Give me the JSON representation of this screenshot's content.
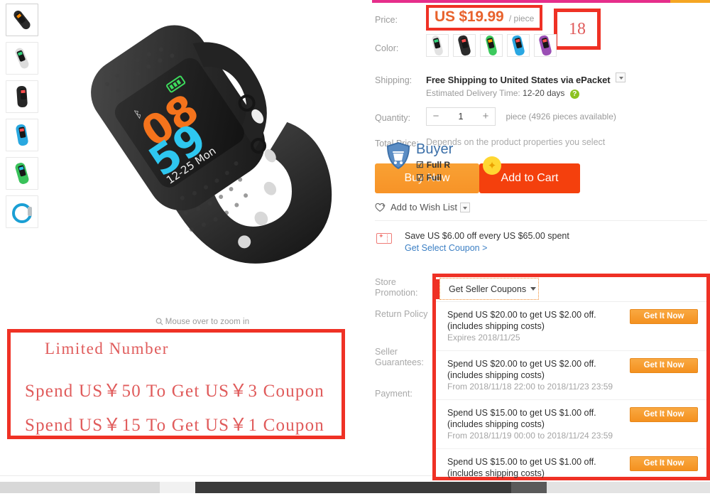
{
  "colors": {
    "annotation_red": "#ef3125",
    "price_orange": "#e8622c",
    "buy_now_orange": "#f79327",
    "add_cart_red": "#f4400d",
    "link_blue": "#3b7fc4",
    "coupon_btn_orange": "#f4911f",
    "top_bar_pink": "#e62e8b",
    "top_bar_orange": "#f5a623"
  },
  "gallery": {
    "thumbs": [
      {
        "name": "thumbnail-black-angled",
        "body": "#2a2a2a",
        "screen_accent": "#ff8a00"
      },
      {
        "name": "thumbnail-white",
        "body": "#dcdcdc",
        "screen_accent": "#33d17a"
      },
      {
        "name": "thumbnail-black-front",
        "body": "#262626",
        "screen_accent": "#ff4d4d"
      },
      {
        "name": "thumbnail-blue",
        "body": "#29a8e0",
        "screen_accent": "#ff4d4d"
      },
      {
        "name": "thumbnail-green",
        "body": "#39c25a",
        "screen_accent": "#29c3e8"
      },
      {
        "name": "thumbnail-cyan-ring",
        "body": "#1a9fd4",
        "screen_accent": "#cccccc"
      }
    ],
    "zoom_hint": "Mouse over to zoom in",
    "zoom_icon": "search-icon",
    "main_image": {
      "name": "product-main-image",
      "alt": "Black smart fitness band, screen showing time",
      "screen_time_top": "08",
      "screen_time_bottom": "59",
      "screen_date": "12-25 Mon",
      "bluetooth_icon": "bluetooth-icon",
      "battery_icon": "battery-icon"
    }
  },
  "annotation_limited": {
    "title": "Limited Number",
    "line2": "Spend US￥50 To Get US￥3 Coupon",
    "line3": "Spend US￥15 To Get US￥1 Coupon"
  },
  "annotation_badge": {
    "value": "18"
  },
  "detail": {
    "price": {
      "label": "Price:",
      "amount": "US $19.99",
      "unit": "/ piece"
    },
    "color": {
      "label": "Color:",
      "options": [
        {
          "name": "swatch-white",
          "body": "#e2e2e2",
          "screen_accent": "#33d17a"
        },
        {
          "name": "swatch-black",
          "body": "#2b2b2b",
          "screen_accent": "#ff4d4d"
        },
        {
          "name": "swatch-green",
          "body": "#3cc95d",
          "screen_accent": "#ffaa00"
        },
        {
          "name": "swatch-blue",
          "body": "#2aa7e2",
          "screen_accent": "#ff4d4d"
        },
        {
          "name": "swatch-purple",
          "body": "#9b4fb5",
          "screen_accent": "#ff4d4d"
        }
      ]
    },
    "shipping": {
      "label": "Shipping:",
      "method": "Free Shipping to United States via ePacket",
      "eta_prefix": "Estimated Delivery Time:",
      "eta_value": "12-20 days",
      "help_icon": "question-mark-icon",
      "dropdown_icon": "chevron-down-icon"
    },
    "quantity": {
      "label": "Quantity:",
      "minus": "−",
      "value": "1",
      "plus": "+",
      "note": "piece (4926 pieces available)"
    },
    "total_price": {
      "label": "Total Price:",
      "note": "Depends on the product properties you select"
    },
    "cta": {
      "buy_now": "Buy Now",
      "add_to_cart": "Add to Cart",
      "click_marker_icon": "sparkle-cursor-icon"
    },
    "wishlist": {
      "label": "Add to Wish List",
      "heart_icon": "heart-plus-icon",
      "dropdown_icon": "chevron-down-icon"
    },
    "select_coupon": {
      "icon": "coupon-ticket-icon",
      "text": "Save US $6.00 off every US $65.00 spent",
      "link": "Get Select Coupon >"
    },
    "tail_labels": {
      "store_promotion": "Store\nPromotion:",
      "store_promotion_l1": "Store",
      "store_promotion_l2": "Promotion:",
      "return_policy": "Return Policy",
      "seller_guarantees_l1": "Seller",
      "seller_guarantees_l2": "Guarantees:",
      "payment": "Payment:"
    },
    "buyer_protection": {
      "shield_icon": "shield-cart-icon",
      "title": "Buyer",
      "item1": "Full R",
      "item2": "Full ",
      "check_icon": "checkbox-checked-icon"
    }
  },
  "seller_coupons": {
    "select_label": "Get Seller Coupons",
    "caret_icon": "caret-down-icon",
    "items": [
      {
        "line1": "Spend US $20.00 to get US $2.00 off.",
        "line2": "(includes shipping costs)",
        "line3": "Expires 2018/11/25",
        "button": "Get It Now"
      },
      {
        "line1": "Spend US $20.00 to get US $2.00 off.",
        "line2": "(includes shipping costs)",
        "line3": "From 2018/11/18 22:00 to 2018/11/23 23:59",
        "button": "Get It Now"
      },
      {
        "line1": "Spend US $15.00 to get US $1.00 off.",
        "line2": "(includes shipping costs)",
        "line3": "From 2018/11/19 00:00 to 2018/11/24 23:59",
        "button": "Get It Now"
      },
      {
        "line1": "Spend US $15.00 to get US $1.00 off.",
        "line2": "(includes shipping costs)",
        "line3": "",
        "button": "Get It Now"
      }
    ]
  }
}
